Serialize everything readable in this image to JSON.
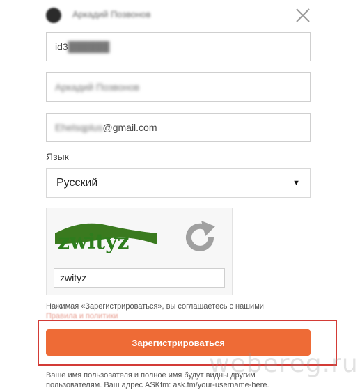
{
  "header": {
    "name": "Аркадий Позвонов"
  },
  "fields": {
    "user_id": "id3",
    "full_name": "Аркадий Позвонов",
    "email_prefix": "Ehelsqplus",
    "email_suffix": "@gmail.com"
  },
  "language": {
    "label": "Язык",
    "selected": "Русский"
  },
  "captcha": {
    "image_text": "zwityz",
    "input_value": "zwityz"
  },
  "terms": {
    "text": "Нажимая «Зарегистрироваться», вы соглашаетесь с нашими",
    "link": "Правила и политики"
  },
  "submit_label": "Зарегистрироваться",
  "footer": {
    "line1": "Ваше имя пользователя и полное имя будут видны другим",
    "line2": "пользователям. Ваш адрес ASKfm: ask.fm/your-username-here."
  },
  "watermark": "webereg.ru",
  "colors": {
    "accent": "#ee6b36",
    "highlight_border": "#d33b36"
  }
}
